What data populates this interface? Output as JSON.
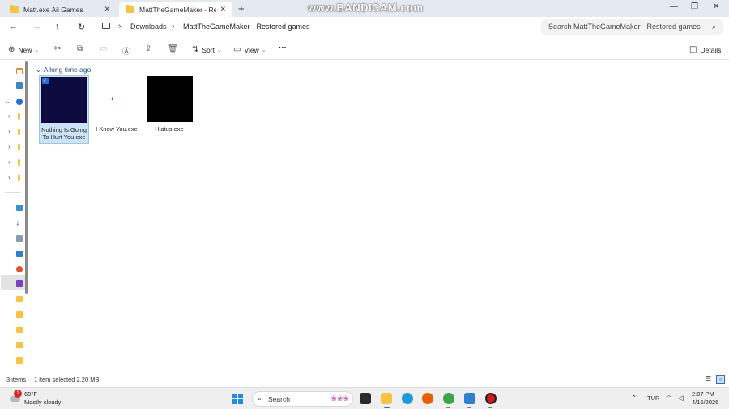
{
  "tabs": [
    {
      "label": "Matt.exe Aii Games",
      "close": "✕"
    },
    {
      "label": "MattTheGameMaker - Restored games",
      "close": "✕"
    }
  ],
  "new_tab": "+",
  "watermark": "www.BANDICAM.com",
  "window_controls": {
    "minimize": "—",
    "maximize": "❐",
    "close": "✕"
  },
  "nav": {
    "back": "←",
    "forward": "→",
    "up": "↑",
    "refresh": "↻"
  },
  "breadcrumb": [
    {
      "label": "Downloads"
    },
    {
      "label": "MattTheGameMaker - Restored games"
    }
  ],
  "search": {
    "placeholder": "Search MattTheGameMaker - Restored games"
  },
  "toolbar": {
    "new_label": "New",
    "sort_label": "Sort",
    "view_label": "View",
    "more_label": "···",
    "details_label": "Details"
  },
  "group": {
    "label": "A long time ago"
  },
  "files": [
    {
      "name": "Nothing Is Going To Hurt You.exe",
      "selected": true
    },
    {
      "name": "I Know You.exe",
      "selected": false
    },
    {
      "name": "Hiatus.exe",
      "selected": false
    }
  ],
  "status": {
    "count": "3 items",
    "selection": "1 item selected  2.20 MB"
  },
  "taskbar": {
    "weather_temp": "60°F",
    "weather_cond": "Mostly cloudy",
    "weather_badge": "1",
    "search_label": "Search",
    "language": "TUR",
    "time": "2:07 PM",
    "date": "4/16/2026"
  },
  "colors": {
    "accent": "#2b6bd6",
    "folder": "#f5c542",
    "selection": "#cce4f7"
  }
}
